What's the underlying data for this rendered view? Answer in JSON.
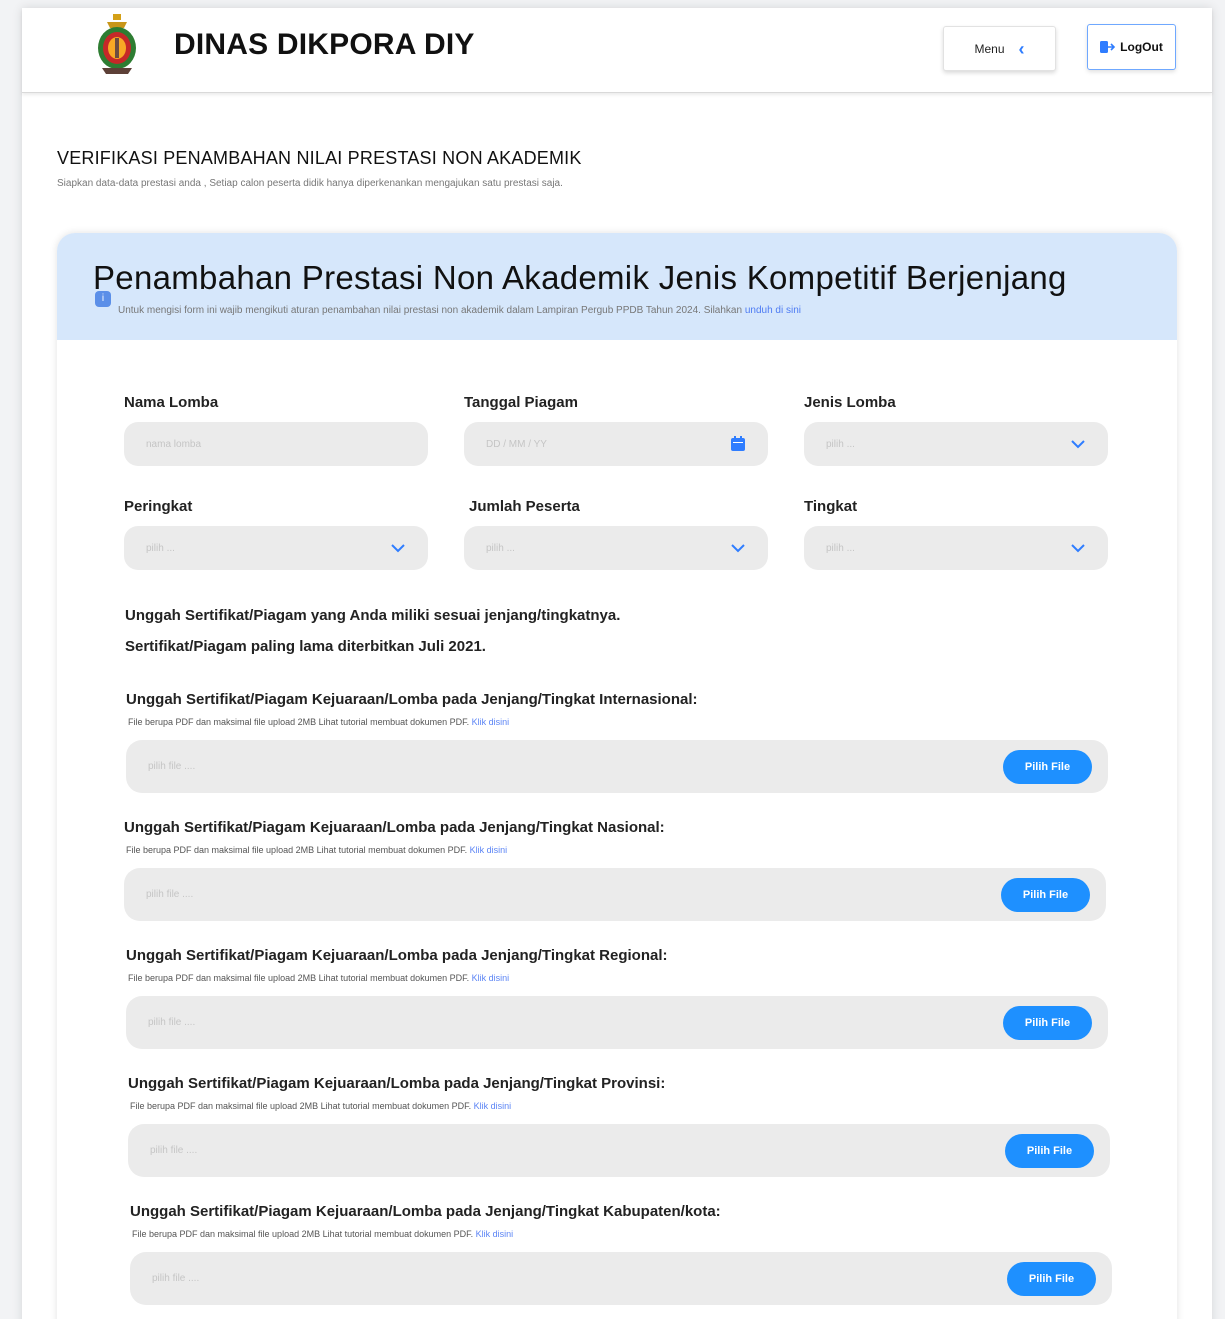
{
  "header": {
    "app_title": "DINAS DIKPORA DIY",
    "menu_label": "Menu",
    "logout_label": "LogOut"
  },
  "page": {
    "heading": "VERIFIKASI PENAMBAHAN NILAI PRESTASI NON AKADEMIK",
    "subheading": "Siapkan data-data prestasi anda , Setiap calon peserta didik hanya diperkenankan mengajukan satu prestasi saja."
  },
  "card": {
    "title": "Penambahan Prestasi Non Akademik Jenis Kompetitif Berjenjang",
    "note": "Untuk mengisi form ini wajib mengikuti aturan penambahan nilai prestasi non akademik dalam Lampiran Pergub PPDB Tahun 2024. Silahkan ",
    "note_link": "unduh di sini"
  },
  "form": {
    "nama_lomba": {
      "label": "Nama Lomba",
      "placeholder": "nama lomba"
    },
    "tanggal_piagam": {
      "label": "Tanggal Piagam",
      "placeholder": "DD / MM / YY"
    },
    "jenis_lomba": {
      "label": "Jenis Lomba",
      "placeholder": "pilih ..."
    },
    "peringkat": {
      "label": "Peringkat",
      "placeholder": "pilih ..."
    },
    "jumlah_peserta": {
      "label": "Jumlah Peserta",
      "placeholder": "pilih ..."
    },
    "tingkat": {
      "label": "Tingkat",
      "placeholder": "pilih ..."
    }
  },
  "upload": {
    "intro_line1": "Unggah Sertifikat/Piagam yang Anda miliki sesuai jenjang/tingkatnya.",
    "intro_line2": "Sertifikat/Piagam paling lama diterbitkan Juli 2021.",
    "note": "File berupa PDF dan maksimal file upload 2MB  Lihat tutorial membuat dokumen PDF. ",
    "note_link": "Klik disini",
    "placeholder": "pilih file ....",
    "button_label": "Pilih File",
    "items": [
      {
        "label": "Unggah Sertifikat/Piagam Kejuaraan/Lomba pada Jenjang/Tingkat Internasional:"
      },
      {
        "label": "Unggah Sertifikat/Piagam Kejuaraan/Lomba pada Jenjang/Tingkat Nasional:"
      },
      {
        "label": "Unggah Sertifikat/Piagam Kejuaraan/Lomba pada Jenjang/Tingkat Regional:"
      },
      {
        "label": "Unggah Sertifikat/Piagam Kejuaraan/Lomba pada Jenjang/Tingkat Provinsi:"
      },
      {
        "label": "Unggah Sertifikat/Piagam Kejuaraan/Lomba pada Jenjang/Tingkat Kabupaten/kota:"
      }
    ]
  },
  "colors": {
    "accent": "#1e90ff",
    "card_header_bg": "#d6e7fb",
    "input_bg": "#ebebeb",
    "link": "#4d7bf3"
  },
  "icons": {
    "logo": "crest-logo",
    "menu": "chevron-left-icon",
    "logout": "logout-icon",
    "info": "info-icon",
    "calendar": "calendar-icon",
    "dropdown": "chevron-down-icon"
  }
}
